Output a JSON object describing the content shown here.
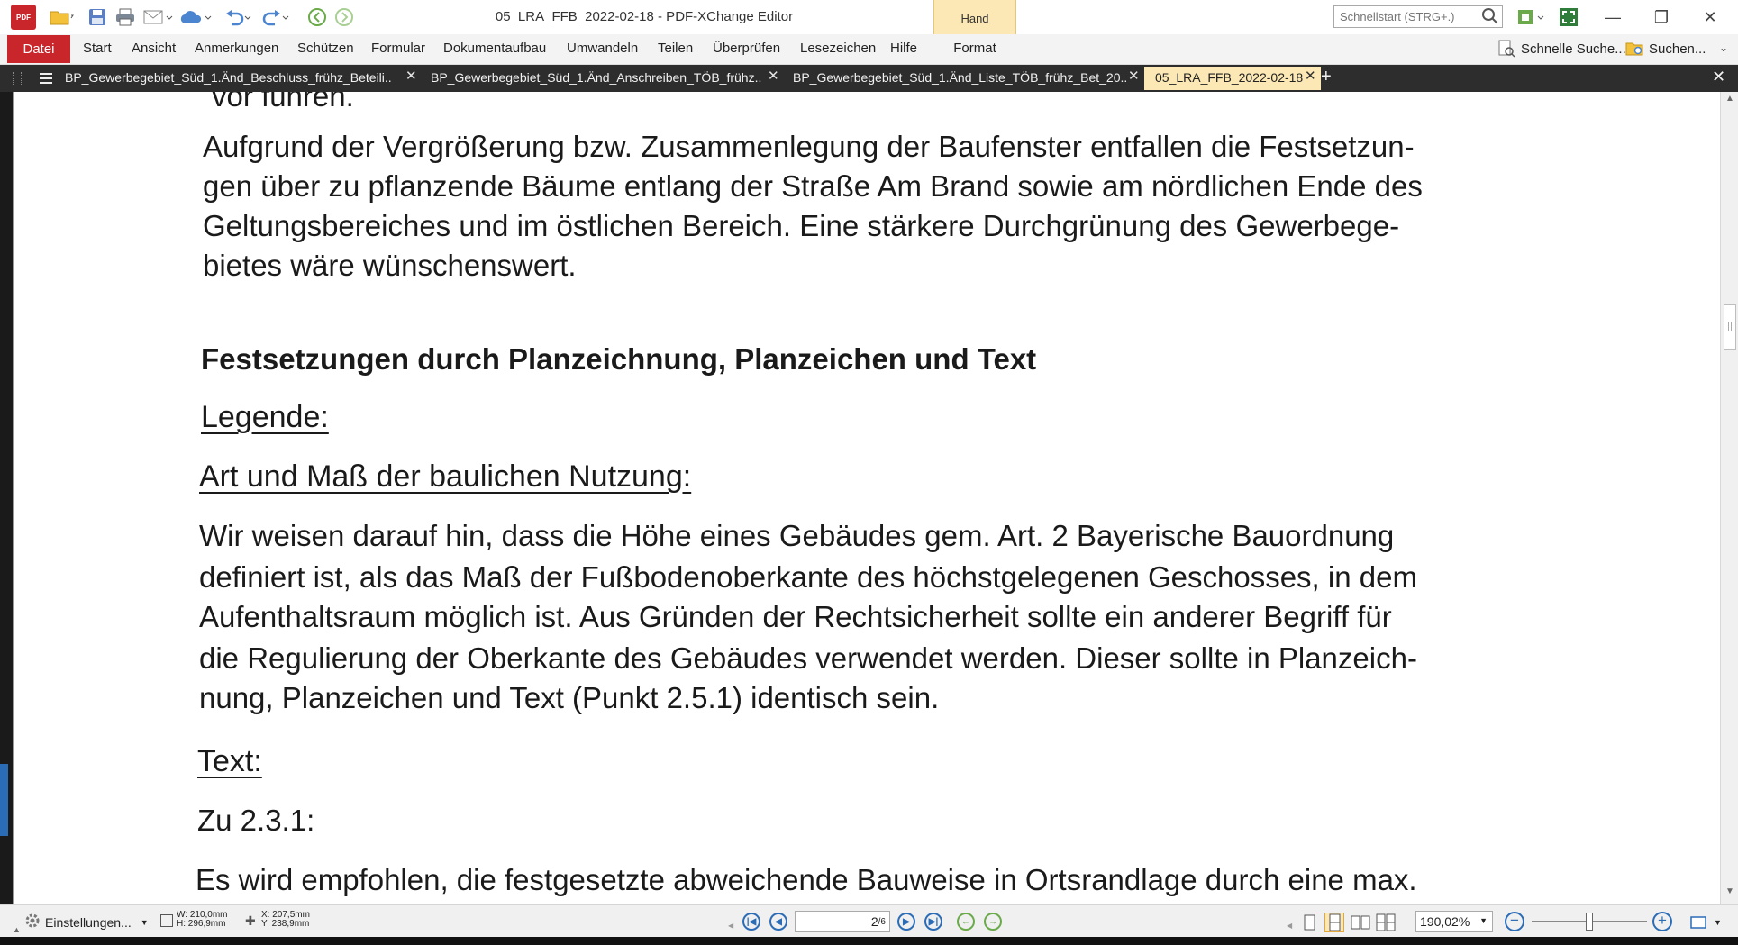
{
  "window": {
    "title": "05_LRA_FFB_2022-02-18 - PDF-XChange Editor",
    "context_tab_group": "Hand",
    "quickstart_placeholder": "Schnellstart (STRG+.)"
  },
  "menu": {
    "file": "Datei",
    "items": [
      "Start",
      "Ansicht",
      "Anmerkungen",
      "Schützen",
      "Formular",
      "Dokumentaufbau",
      "Umwandeln",
      "Teilen",
      "Überprüfen",
      "Lesezeichen",
      "Hilfe"
    ],
    "context_item": "Format",
    "quick_search": "Schnelle Suche...",
    "search": "Suchen..."
  },
  "tabs": [
    {
      "label": "BP_Gewerbegebiet_Süd_1.Änd_Beschluss_frühz_Beteili..",
      "active": false
    },
    {
      "label": "BP_Gewerbegebiet_Süd_1.Änd_Anschreiben_TÖB_frühz..",
      "active": false
    },
    {
      "label": "BP_Gewerbegebiet_Süd_1.Änd_Liste_TÖB_frühz_Bet_20..",
      "active": false
    },
    {
      "label": "05_LRA_FFB_2022-02-18",
      "active": true
    }
  ],
  "document": {
    "cut_line": "vor führen.",
    "para1": [
      "Aufgrund der Vergrößerung bzw. Zusammenlegung der Baufenster entfallen die Festsetzun-",
      "gen über zu pflanzende Bäume entlang der Straße Am Brand sowie am nördlichen Ende des",
      "Geltungsbereiches und im östlichen Bereich. Eine stärkere Durchgrünung des Gewerbege-",
      "bietes wäre wünschenswert."
    ],
    "heading": "Festsetzungen durch Planzeichnung, Planzeichen und Text",
    "legend": "Legende:",
    "usage_heading": "Art und Maß der baulichen Nutzung:",
    "para2": [
      "Wir weisen darauf hin, dass die Höhe eines Gebäudes gem. Art. 2 Bayerische Bauordnung",
      "definiert ist, als das Maß der Fußbodenoberkante des höchstgelegenen Geschosses, in dem",
      "Aufenthaltsraum möglich ist. Aus Gründen der Rechtsicherheit sollte ein anderer Begriff für",
      "die Regulierung der Oberkante des Gebäudes verwendet werden. Dieser sollte in Planzeich-",
      "nung, Planzeichen und Text (Punkt 2.5.1) identisch sein."
    ],
    "text_heading": "Text:",
    "section": "Zu 2.3.1:",
    "para3": "Es wird empfohlen, die festgesetzte abweichende Bauweise in Ortsrandlage durch eine max."
  },
  "status": {
    "settings": "Einstellungen...",
    "width": "W: 210,0mm",
    "height": "H: 296,9mm",
    "x": "X: 207,5mm",
    "y": "Y: 238,9mm",
    "page_current": "2",
    "page_total": "/6",
    "zoom": "190,02%",
    "zoom_slider_fraction": 0.5
  },
  "colors": {
    "brand_red": "#c8262b",
    "context_tab": "#fbe8b5",
    "nav_blue": "#2b6cb7"
  }
}
